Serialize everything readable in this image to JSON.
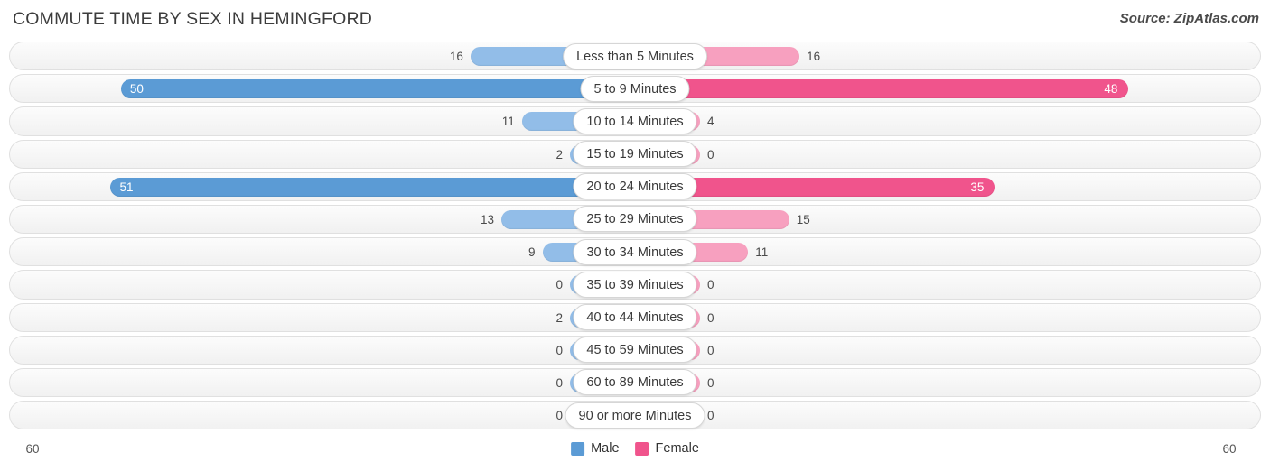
{
  "header": {
    "title": "COMMUTE TIME BY SEX IN HEMINGFORD",
    "source": "Source: ZipAtlas.com"
  },
  "legend": {
    "male_label": "Male",
    "female_label": "Female",
    "male_color": "#5b9bd5",
    "female_color": "#f0548c"
  },
  "axis": {
    "left_label": "60",
    "right_label": "60",
    "max": 60
  },
  "chart_data": {
    "type": "bar",
    "orientation": "horizontal-diverging",
    "title": "COMMUTE TIME BY SEX IN HEMINGFORD",
    "xlabel": "",
    "ylabel": "",
    "xlim": [
      60,
      60
    ],
    "grid": false,
    "legend_position": "bottom-center",
    "categories": [
      "Less than 5 Minutes",
      "5 to 9 Minutes",
      "10 to 14 Minutes",
      "15 to 19 Minutes",
      "20 to 24 Minutes",
      "25 to 29 Minutes",
      "30 to 34 Minutes",
      "35 to 39 Minutes",
      "40 to 44 Minutes",
      "45 to 59 Minutes",
      "60 to 89 Minutes",
      "90 or more Minutes"
    ],
    "series": [
      {
        "name": "Male",
        "values": [
          16,
          50,
          11,
          2,
          51,
          13,
          9,
          0,
          2,
          0,
          0,
          0
        ]
      },
      {
        "name": "Female",
        "values": [
          16,
          48,
          4,
          0,
          35,
          15,
          11,
          0,
          0,
          0,
          0,
          0
        ]
      }
    ]
  },
  "rows": [
    {
      "label": "Less than 5 Minutes",
      "male": "16",
      "female": "16",
      "male_hi": false,
      "female_hi": false
    },
    {
      "label": "5 to 9 Minutes",
      "male": "50",
      "female": "48",
      "male_hi": true,
      "female_hi": true
    },
    {
      "label": "10 to 14 Minutes",
      "male": "11",
      "female": "4",
      "male_hi": false,
      "female_hi": false
    },
    {
      "label": "15 to 19 Minutes",
      "male": "2",
      "female": "0",
      "male_hi": false,
      "female_hi": false
    },
    {
      "label": "20 to 24 Minutes",
      "male": "51",
      "female": "35",
      "male_hi": true,
      "female_hi": true
    },
    {
      "label": "25 to 29 Minutes",
      "male": "13",
      "female": "15",
      "male_hi": false,
      "female_hi": false
    },
    {
      "label": "30 to 34 Minutes",
      "male": "9",
      "female": "11",
      "male_hi": false,
      "female_hi": false
    },
    {
      "label": "35 to 39 Minutes",
      "male": "0",
      "female": "0",
      "male_hi": false,
      "female_hi": false
    },
    {
      "label": "40 to 44 Minutes",
      "male": "2",
      "female": "0",
      "male_hi": false,
      "female_hi": false
    },
    {
      "label": "45 to 59 Minutes",
      "male": "0",
      "female": "0",
      "male_hi": false,
      "female_hi": false
    },
    {
      "label": "60 to 89 Minutes",
      "male": "0",
      "female": "0",
      "male_hi": false,
      "female_hi": false
    },
    {
      "label": "90 or more Minutes",
      "male": "0",
      "female": "0",
      "male_hi": false,
      "female_hi": false
    }
  ]
}
